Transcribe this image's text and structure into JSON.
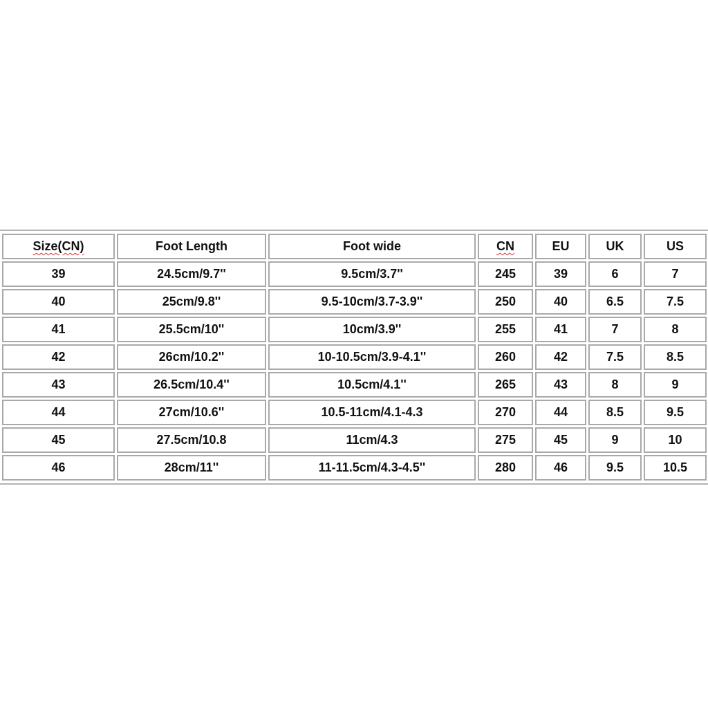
{
  "size_table": {
    "headers": [
      "Size(CN)",
      "Foot Length",
      "Foot wide",
      "CN",
      "EU",
      "UK",
      "US"
    ],
    "rows": [
      [
        "39",
        "24.5cm/9.7''",
        "9.5cm/3.7''",
        "245",
        "39",
        "6",
        "7"
      ],
      [
        "40",
        "25cm/9.8''",
        "9.5-10cm/3.7-3.9''",
        "250",
        "40",
        "6.5",
        "7.5"
      ],
      [
        "41",
        "25.5cm/10''",
        "10cm/3.9''",
        "255",
        "41",
        "7",
        "8"
      ],
      [
        "42",
        "26cm/10.2''",
        "10-10.5cm/3.9-4.1''",
        "260",
        "42",
        "7.5",
        "8.5"
      ],
      [
        "43",
        "26.5cm/10.4''",
        "10.5cm/4.1''",
        "265",
        "43",
        "8",
        "9"
      ],
      [
        "44",
        "27cm/10.6''",
        "10.5-11cm/4.1-4.3",
        "270",
        "44",
        "8.5",
        "9.5"
      ],
      [
        "45",
        "27.5cm/10.8",
        "11cm/4.3",
        "275",
        "45",
        "9",
        "10"
      ],
      [
        "46",
        "28cm/11''",
        "11-11.5cm/4.3-4.5''",
        "280",
        "46",
        "9.5",
        "10.5"
      ]
    ]
  }
}
